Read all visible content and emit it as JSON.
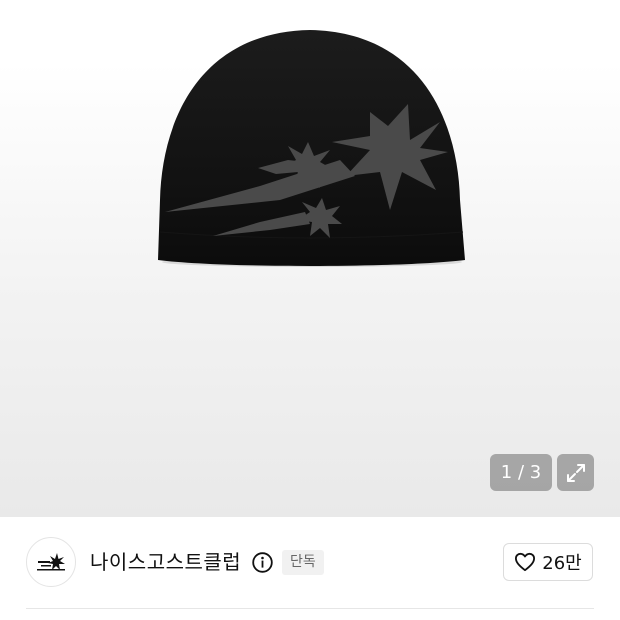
{
  "gallery": {
    "current": "1",
    "separator": " / ",
    "total": "3",
    "image_subject": "black knit beanie with grey shooting-star jacquard pattern"
  },
  "brand": {
    "name": "나이스고스트클럽",
    "badge": "단독",
    "logo_icon": "star-burst-logo-icon",
    "info_icon": "info-circle-icon"
  },
  "like": {
    "icon": "heart-outline-icon",
    "count": "26만"
  },
  "colors": {
    "beanie": "#111111",
    "pattern": "#4a4a4a",
    "overlay": "#969696"
  }
}
